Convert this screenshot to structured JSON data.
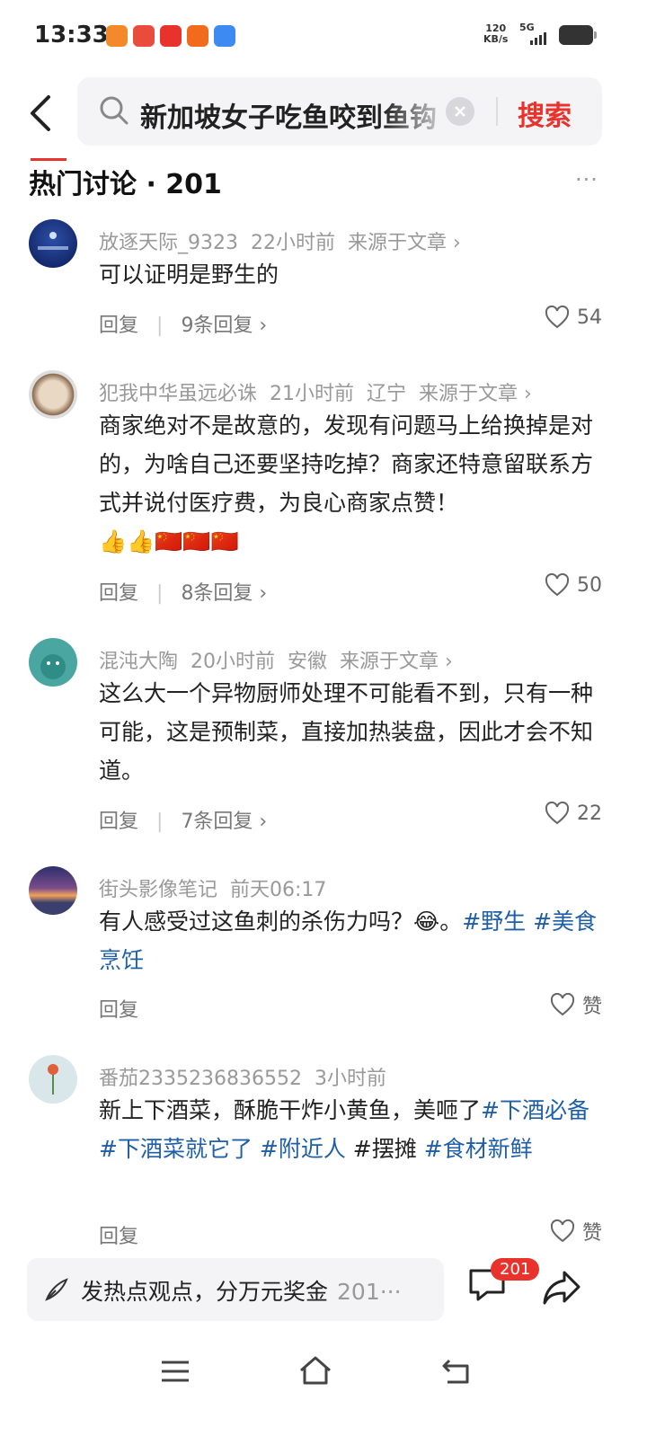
{
  "status_bar": {
    "time": "13:33",
    "net_speed_value": "120",
    "net_speed_unit": "KB/s",
    "signal": "5G"
  },
  "search": {
    "query": "新加坡女子吃鱼咬到鱼钩",
    "button_label": "搜索"
  },
  "section": {
    "title": "热门讨论 · 201",
    "more_label": "···"
  },
  "comments": [
    {
      "user": "放逐天际_9323",
      "time": "22小时前",
      "location": "",
      "source": "来源于文章 ›",
      "text": "可以证明是野生的",
      "reply_label": "回复",
      "replies": "9条回复 ›",
      "likes": "54"
    },
    {
      "user": "犯我中华虽远必诛",
      "time": "21小时前",
      "location": "辽宁",
      "source": "来源于文章 ›",
      "text": "商家绝对不是故意的，发现有问题马上给换掉是对的，为啥自己还要坚持吃掉？商家还特意留联系方式并说付医疗费，为良心商家点赞！",
      "emoji": "👍👍🇨🇳🇨🇳🇨🇳",
      "reply_label": "回复",
      "replies": "8条回复 ›",
      "likes": "50"
    },
    {
      "user": "混沌大陶",
      "time": "20小时前",
      "location": "安徽",
      "source": "来源于文章 ›",
      "text": "这么大一个异物厨师处理不可能看不到，只有一种可能，这是预制菜，直接加热装盘，因此才会不知道。",
      "reply_label": "回复",
      "replies": "7条回复 ›",
      "likes": "22"
    },
    {
      "user": "街头影像笔记",
      "time": "前天06:17",
      "text_plain": "有人感受过这鱼刺的杀伤力吗？😂。",
      "tag1": "#野生 #美食烹饪",
      "reply_label": "回复",
      "likes": "赞"
    },
    {
      "user": "番茄2335236836552",
      "time": "3小时前",
      "text_plain": "新上下酒菜，酥脆干炸小黄鱼，美咂了",
      "tag1": "#下酒必备 #下酒菜就它了 #附近人",
      "tag_plain": " #摆摊 ",
      "tag2": "#食材新鲜",
      "reply_label": "回复",
      "likes": "赞"
    }
  ],
  "bottom_bar": {
    "compose_placeholder": "发热点观点，分万元奖金",
    "compose_count": "201···",
    "comment_badge": "201"
  },
  "colors": {
    "accent_red": "#e8322b",
    "tag_blue": "#1f5fa8",
    "meta_gray": "#999999"
  }
}
